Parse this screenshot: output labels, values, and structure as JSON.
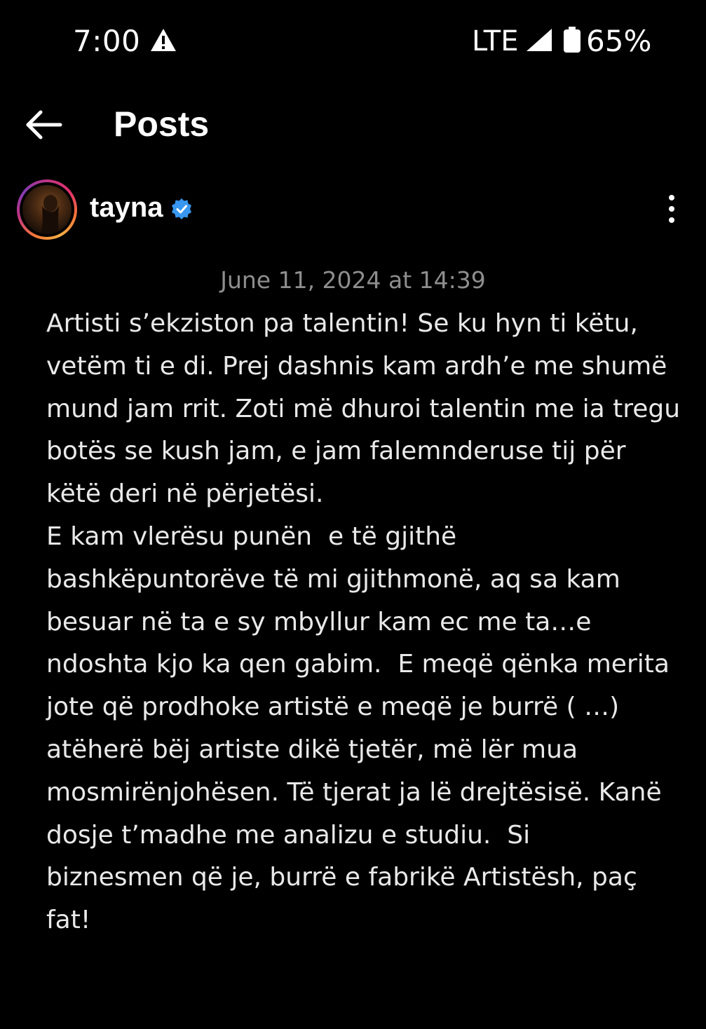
{
  "status_bar": {
    "time": "7:00",
    "network": "LTE",
    "battery": "65%",
    "icons": [
      "warning-icon",
      "signal-icon",
      "battery-icon"
    ]
  },
  "header": {
    "title": "Posts",
    "back_icon": "arrow-left-icon"
  },
  "post": {
    "username": "tayna",
    "verified": true,
    "timestamp": "June 11, 2024 at 14:39",
    "caption_lines": [
      "Artisti s’ekziston pa talentin! Se ku hyn ti këtu,",
      "vetëm ti e di. Prej dashnis kam ardh’e me shumë",
      "mund jam rrit. Zoti më dhuroi talentin me ia tregu",
      "botës se kush jam, e jam falemnderuse tij për",
      "këtë deri në përjetësi.",
      "E kam vlerësu punën  e të gjithë",
      "bashkëpuntorëve të mi gjithmonë, aq sa kam",
      "besuar në ta e sy mbyllur kam ec me ta…e",
      "ndoshta kjo ka qen gabim.  E meqë qënka merita",
      "jote që prodhoke artistë e meqë je burrë ( …)",
      "atëherë bëj artiste dikë tjetër, më lër mua",
      "mosmirënjohësen. Të tjerat ja lë drejtësisë. Kanë",
      "dosje t’madhe me analizu e studiu.  Si",
      "biznesmen që je, burrë e fabrikë Artistësh, paç",
      "fat!"
    ]
  },
  "colors": {
    "background": "#000000",
    "text": "#ffffff",
    "caption_text": "#e9e9e9",
    "timestamp_text": "#8e8e8e",
    "verified_blue": "#3897f0"
  }
}
